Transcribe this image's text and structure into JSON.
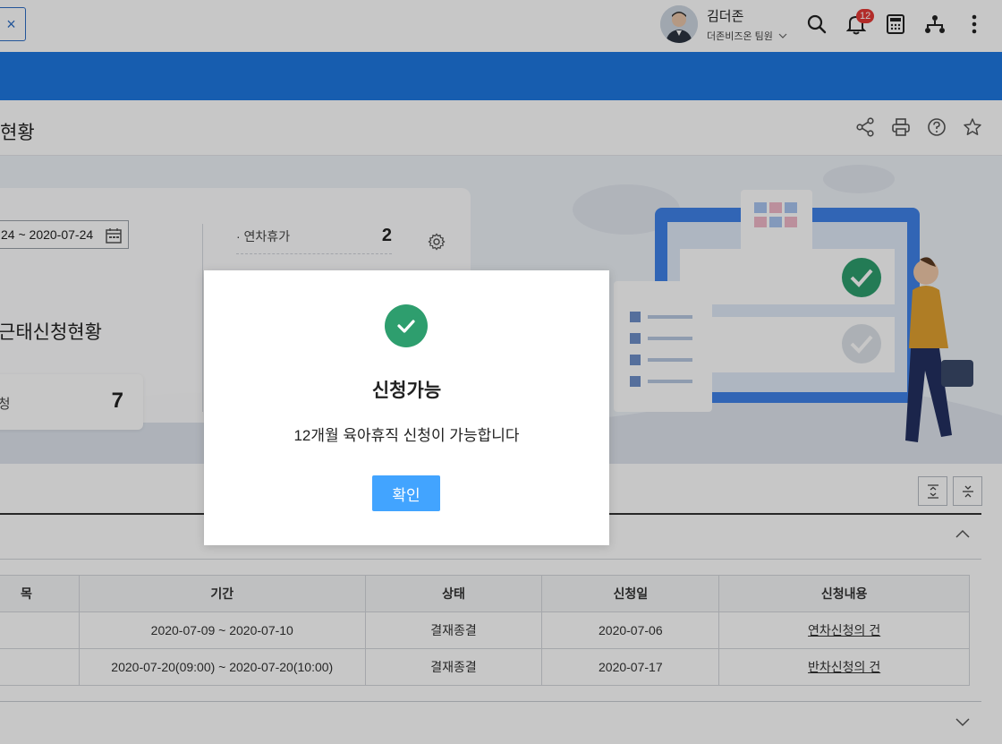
{
  "header": {
    "close_label": "×",
    "user_name": "김더존",
    "user_team": "더존비즈온 팀원",
    "notification_count": "12"
  },
  "page": {
    "title": "현황"
  },
  "banner": {
    "date_range": "24 ~ 2020-07-24",
    "heading": "근태신청현황",
    "stat_label": "신청",
    "stat_value": "7",
    "leave_items": [
      {
        "label": "· 연차휴가",
        "value": "2"
      }
    ]
  },
  "table": {
    "headers": [
      "목",
      "기간",
      "상태",
      "신청일",
      "신청내용"
    ],
    "rows": [
      [
        "",
        "2020-07-09 ~ 2020-07-10",
        "결재종결",
        "2020-07-06",
        "연차신청의 건"
      ],
      [
        "",
        "2020-07-20(09:00) ~ 2020-07-20(10:00)",
        "결재종결",
        "2020-07-17",
        "반차신청의 건"
      ]
    ]
  },
  "modal": {
    "title": "신청가능",
    "message": "12개월 육아휴직 신청이 가능합니다",
    "confirm_label": "확인"
  },
  "colors": {
    "brand_blue": "#1e78e0",
    "success_green": "#2e9e6e",
    "button_blue": "#42a4ff"
  }
}
